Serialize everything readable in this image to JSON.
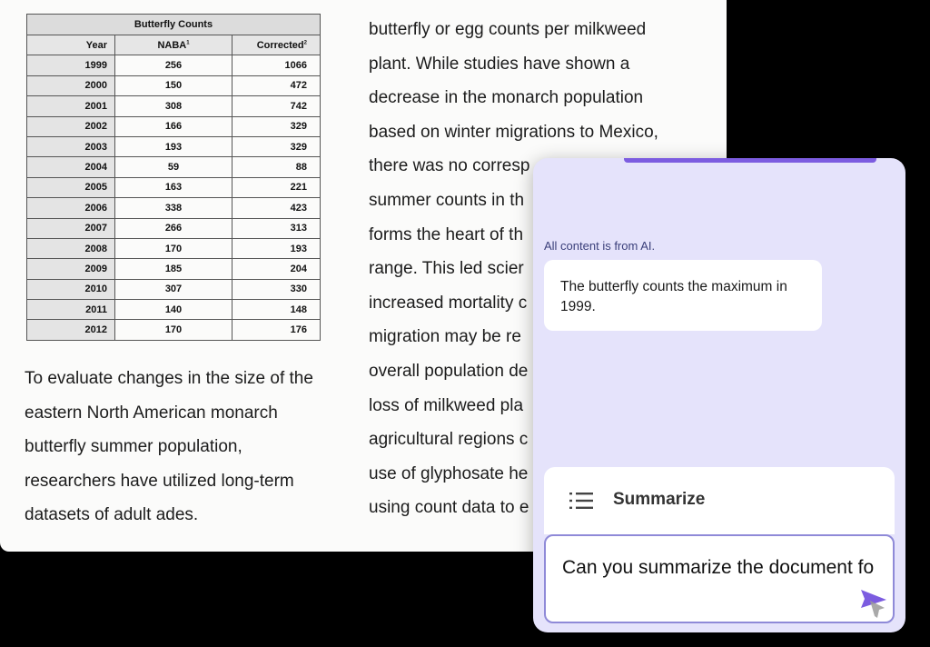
{
  "table": {
    "caption": "Butterfly Counts",
    "columns": [
      "Year",
      "NABA",
      "Corrected"
    ],
    "footnotes": [
      "1",
      "2"
    ],
    "rows": [
      [
        "1999",
        "256",
        "1066"
      ],
      [
        "2000",
        "150",
        "472"
      ],
      [
        "2001",
        "308",
        "742"
      ],
      [
        "2002",
        "166",
        "329"
      ],
      [
        "2003",
        "193",
        "329"
      ],
      [
        "2004",
        "59",
        "88"
      ],
      [
        "2005",
        "163",
        "221"
      ],
      [
        "2006",
        "338",
        "423"
      ],
      [
        "2007",
        "266",
        "313"
      ],
      [
        "2008",
        "170",
        "193"
      ],
      [
        "2009",
        "185",
        "204"
      ],
      [
        "2010",
        "307",
        "330"
      ],
      [
        "2011",
        "140",
        "148"
      ],
      [
        "2012",
        "170",
        "176"
      ]
    ]
  },
  "document": {
    "left_lines": [
      "To evaluate changes in the size of the",
      "eastern North American monarch",
      "butterfly summer population,",
      "researchers have utilized long-term",
      "datasets of adult ades."
    ],
    "right_lines": [
      "butterfly or egg counts per milkweed",
      "plant. While studies have shown a",
      "decrease in the monarch population",
      "based on winter migrations to Mexico,",
      "there was no corresp",
      "summer counts in th",
      "forms the heart of th",
      "range. This led scier",
      "increased mortality c",
      "migration may be re",
      "overall population de",
      "loss of milkweed pla",
      "agricultural regions c",
      "use of glyphosate he",
      "using count data to e"
    ]
  },
  "ai_panel": {
    "notice": "All content is from AI.",
    "response": "The butterfly counts the maximum in 1999.",
    "summarize_label": "Summarize",
    "input_value": "Can you summarize the document fo",
    "accent_color": "#7c5ce0",
    "icons": [
      "list-icon",
      "send-icon"
    ]
  }
}
